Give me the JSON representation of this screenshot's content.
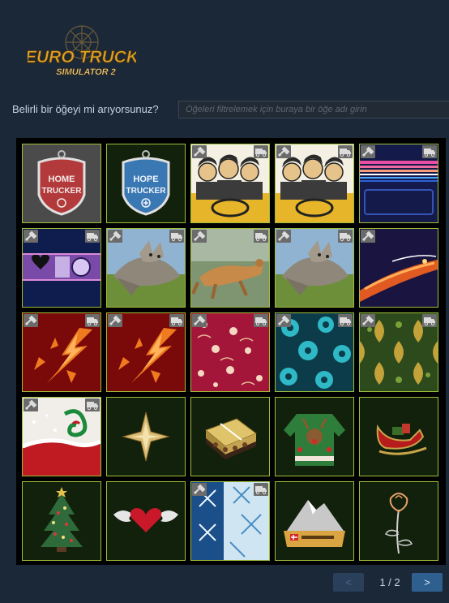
{
  "logo": {
    "line1": "EURO TRUCK",
    "line2": "SIMULATOR 2"
  },
  "search": {
    "label": "Belirli bir öğeyi mi arıyorsunuz?",
    "placeholder": "Öğeleri filtrelemek için buraya bir öğe adı girin",
    "value": ""
  },
  "colors": {
    "slot_border": "#9fbe39",
    "slot_bg": "#12210b",
    "page_bg": "#1b2838"
  },
  "inventory": [
    {
      "name": "home-trucker-badge",
      "badges": []
    },
    {
      "name": "hope-trucker-badge",
      "badges": []
    },
    {
      "name": "comic-truckers-paintjob",
      "badges": [
        "tool",
        "truck"
      ]
    },
    {
      "name": "comic-truckers-paintjob-2",
      "badges": [
        "tool",
        "truck"
      ]
    },
    {
      "name": "neon-stripes-paintjob",
      "badges": [
        "tool",
        "truck"
      ]
    },
    {
      "name": "hearts-paintjob",
      "badges": [
        "tool",
        "truck"
      ]
    },
    {
      "name": "wolves-paintjob",
      "badges": [
        "tool",
        "truck"
      ]
    },
    {
      "name": "lynx-paintjob",
      "badges": [
        "tool",
        "truck"
      ]
    },
    {
      "name": "wolves-paintjob-2",
      "badges": [
        "tool",
        "truck"
      ]
    },
    {
      "name": "comet-paintjob",
      "badges": [
        "tool"
      ]
    },
    {
      "name": "red-explosion-paintjob",
      "badges": [
        "tool",
        "truck"
      ]
    },
    {
      "name": "red-explosion-paintjob-2",
      "badges": [
        "tool",
        "truck"
      ]
    },
    {
      "name": "red-floral-paintjob",
      "badges": [
        "tool",
        "truck"
      ]
    },
    {
      "name": "teal-snowflake-paintjob",
      "badges": [
        "tool",
        "truck"
      ]
    },
    {
      "name": "green-damask-paintjob",
      "badges": [
        "tool",
        "truck"
      ]
    },
    {
      "name": "santa-wave-paintjob",
      "badges": [
        "tool",
        "truck"
      ]
    },
    {
      "name": "golden-star-ornament",
      "badges": []
    },
    {
      "name": "chocolate-box-item",
      "badges": []
    },
    {
      "name": "reindeer-sweater-item",
      "badges": []
    },
    {
      "name": "sleigh-item",
      "badges": []
    },
    {
      "name": "christmas-tree-item",
      "badges": []
    },
    {
      "name": "winged-heart-item",
      "badges": []
    },
    {
      "name": "blue-frost-paintjob",
      "badges": [
        "tool",
        "truck"
      ]
    },
    {
      "name": "matterhorn-item",
      "badges": []
    },
    {
      "name": "rose-item",
      "badges": []
    }
  ],
  "pager": {
    "prev": "<",
    "next": ">",
    "page_text": "1 / 2"
  }
}
